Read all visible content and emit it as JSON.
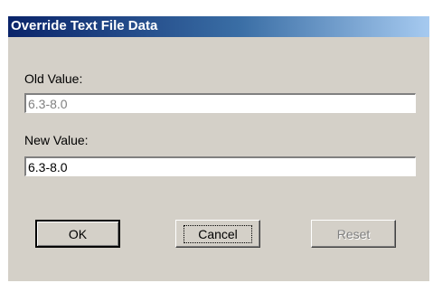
{
  "dialog": {
    "title": "Override Text File Data"
  },
  "old_value": {
    "label": "Old Value:",
    "value": "6.3-8.0",
    "enabled": false
  },
  "new_value": {
    "label": "New Value:",
    "value": "6.3-8.0",
    "enabled": true
  },
  "buttons": {
    "ok": "OK",
    "cancel": "Cancel",
    "reset": "Reset",
    "reset_enabled": false
  },
  "colors": {
    "dialog_bg": "#d4d0c8",
    "titlebar_start": "#0a246a",
    "titlebar_end": "#a6caf0",
    "disabled_text": "#808080"
  }
}
